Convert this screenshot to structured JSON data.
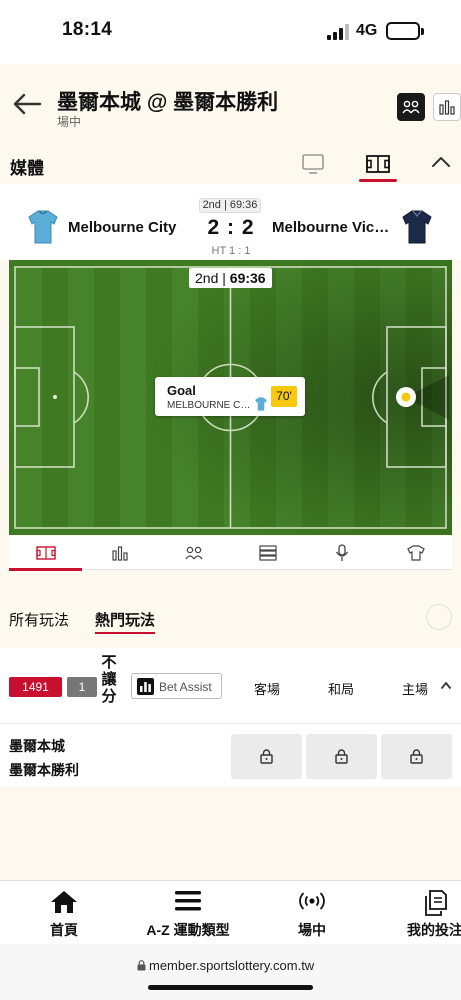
{
  "status_bar": {
    "time": "18:14",
    "network": "4G"
  },
  "header": {
    "title": "墨爾本城 @ 墨爾本勝利",
    "subtitle": "場中"
  },
  "media": {
    "label": "媒體"
  },
  "match": {
    "period_clock": "2nd | 69:36",
    "home_team": "Melbourne City",
    "away_team": "Melbourne Victory",
    "score": "2 : 2",
    "half_time": "HT 1 : 1",
    "pitch_period": "2nd",
    "pitch_time": "69:36",
    "event": {
      "title": "Goal",
      "team": "MELBOURNE CITY",
      "minute": "70'"
    },
    "colors": {
      "home_shirt": "#5aaed8",
      "away_shirt": "#1c2a4a",
      "pitch": "#3f7a22",
      "accent": "#c8102e"
    }
  },
  "market_tabs": {
    "all": "所有玩法",
    "popular": "熱門玩法"
  },
  "market": {
    "badge_id": "1491",
    "badge_count": "1",
    "handicap_label": "不\n讓\n分",
    "bet_assist": "Bet Assist",
    "columns": {
      "away": "客場",
      "draw": "和局",
      "home": "主場"
    },
    "row": {
      "team_a": "墨爾本城",
      "team_b": "墨爾本勝利"
    }
  },
  "bottom_nav": [
    {
      "label": "首頁",
      "icon": "home-icon"
    },
    {
      "label": "A-Z 運動類型",
      "icon": "menu-icon"
    },
    {
      "label": "場中",
      "icon": "live-broadcast-icon"
    },
    {
      "label": "我的投注",
      "icon": "betslip-icon"
    }
  ],
  "browser": {
    "url": "member.sportslottery.com.tw"
  }
}
